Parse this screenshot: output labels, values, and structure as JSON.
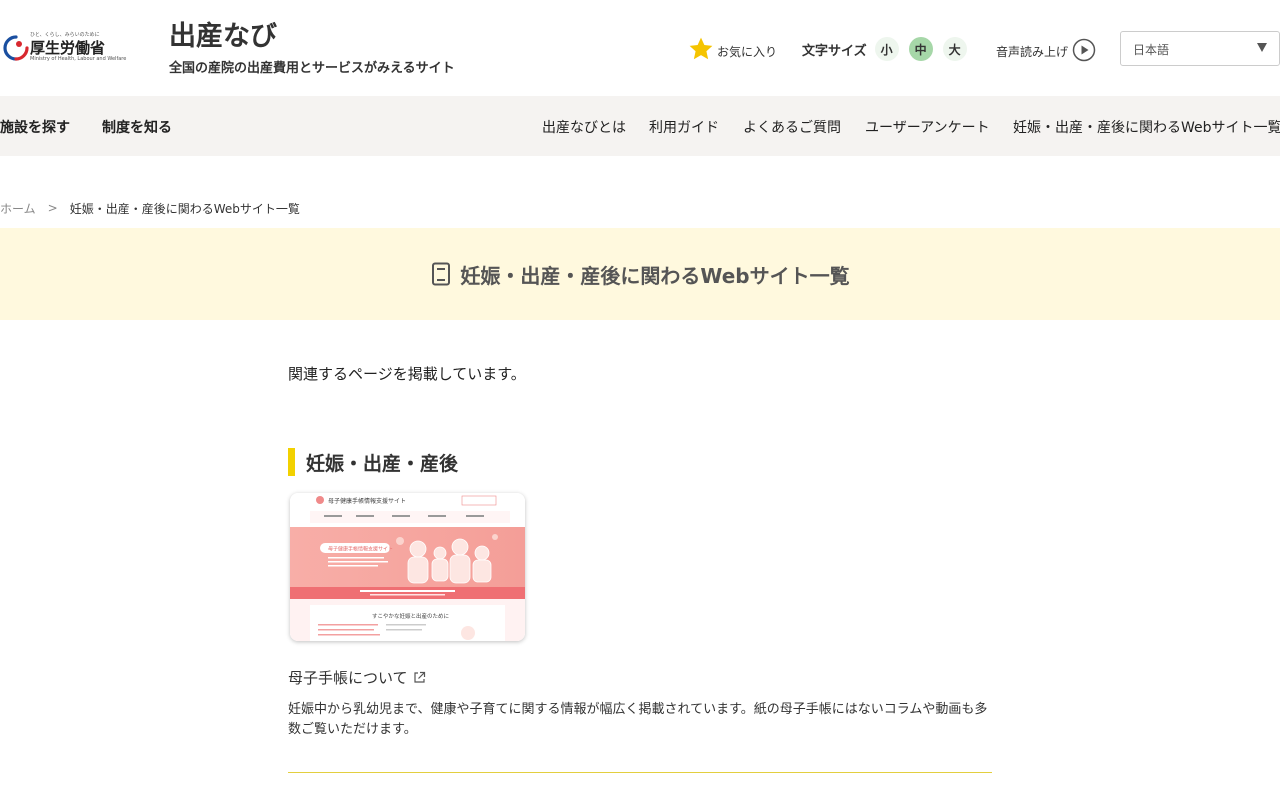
{
  "header": {
    "ministry": {
      "tagline_top": "ひと、くらし、みらいのために",
      "name": "厚生労働省",
      "name_en": "Ministry of Health, Labour and Welfare"
    },
    "site_title": "出産なび",
    "site_tagline": "全国の産院の出産費用とサービスがみえるサイト",
    "favorites_label": "お気に入り",
    "font_size": {
      "label": "文字サイズ",
      "small": "小",
      "medium": "中",
      "large": "大"
    },
    "tts_label": "音声読み上げ",
    "language": {
      "selected": "日本語"
    }
  },
  "nav": {
    "left": [
      "施設を探す",
      "制度を知る"
    ],
    "right": [
      "出産なびとは",
      "利用ガイド",
      "よくあるご質問",
      "ユーザーアンケート",
      "妊娠・出産・産後に関わるWebサイト一覧"
    ]
  },
  "breadcrumb": {
    "home": "ホーム",
    "separator": ">",
    "current": "妊娠・出産・産後に関わるWebサイト一覧"
  },
  "banner": {
    "title": "妊娠・出産・産後に関わるWebサイト一覧"
  },
  "intro": "関連するページを掲載しています。",
  "section": {
    "title": "妊娠・出産・産後",
    "item": {
      "thumb_site_name": "母子健康手帳情報支援サイト",
      "thumb_hero_label": "母子健康手帳情報支援サイト",
      "thumb_section": "すこやかな妊娠と出産のために",
      "title": "母子手帳について",
      "description": "妊娠中から乳幼児まで、健康や子育てに関する情報が幅広く掲載されています。紙の母子手帳にはないコラムや動画も多数ご覧いただけます。"
    }
  },
  "colors": {
    "accent_yellow": "#f2d100",
    "banner_bg": "#fff9de",
    "nav_bg": "#f5f3f1",
    "font_size_active": "#a6d7a8",
    "star": "#f5c400"
  }
}
